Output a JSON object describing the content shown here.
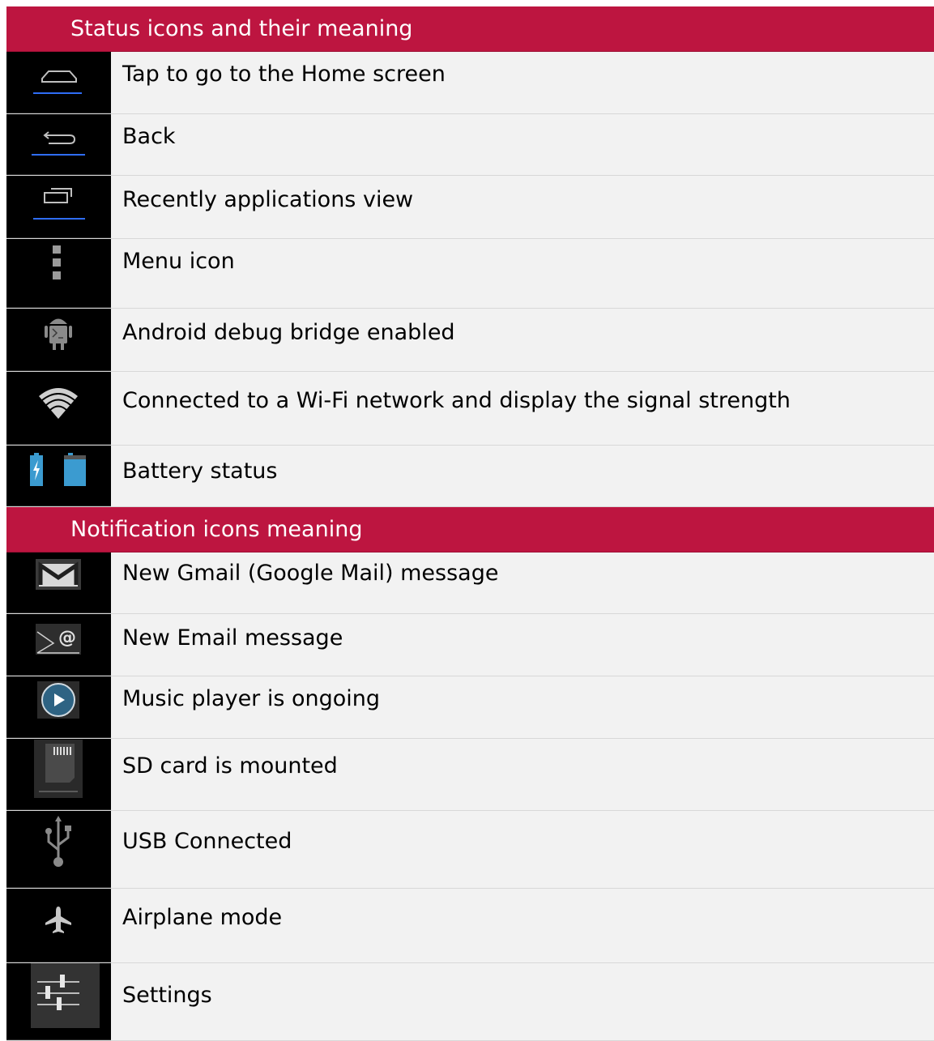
{
  "sections": [
    {
      "title": "Status icons and their meaning",
      "rows": [
        {
          "icon": "home-icon",
          "text": "Tap to go to the Home screen"
        },
        {
          "icon": "back-icon",
          "text": "Back"
        },
        {
          "icon": "recent-apps-icon",
          "text": "Recently applications view"
        },
        {
          "icon": "menu-icon",
          "text": "Menu icon"
        },
        {
          "icon": "android-debug-icon",
          "text": "Android debug bridge enabled"
        },
        {
          "icon": "wifi-icon",
          "text": "Connected to a Wi-Fi network and display the signal strength"
        },
        {
          "icon": "battery-icon",
          "text": "Battery status"
        }
      ]
    },
    {
      "title": "Notification icons meaning",
      "rows": [
        {
          "icon": "gmail-icon",
          "text": "New Gmail (Google Mail) message"
        },
        {
          "icon": "email-icon",
          "text": "New Email message"
        },
        {
          "icon": "music-play-icon",
          "text": "Music player is ongoing"
        },
        {
          "icon": "sd-card-icon",
          "text": "SD card is mounted"
        },
        {
          "icon": "usb-icon",
          "text": "USB Connected"
        },
        {
          "icon": "airplane-icon",
          "text": "Airplane mode"
        },
        {
          "icon": "settings-icon",
          "text": "Settings"
        }
      ]
    }
  ],
  "colors": {
    "header_bg": "#bd1540",
    "icon_bg": "#000000",
    "text_bg": "#f2f2f2",
    "accent_blue": "#2f6df6",
    "battery_blue": "#3b9bd0"
  }
}
